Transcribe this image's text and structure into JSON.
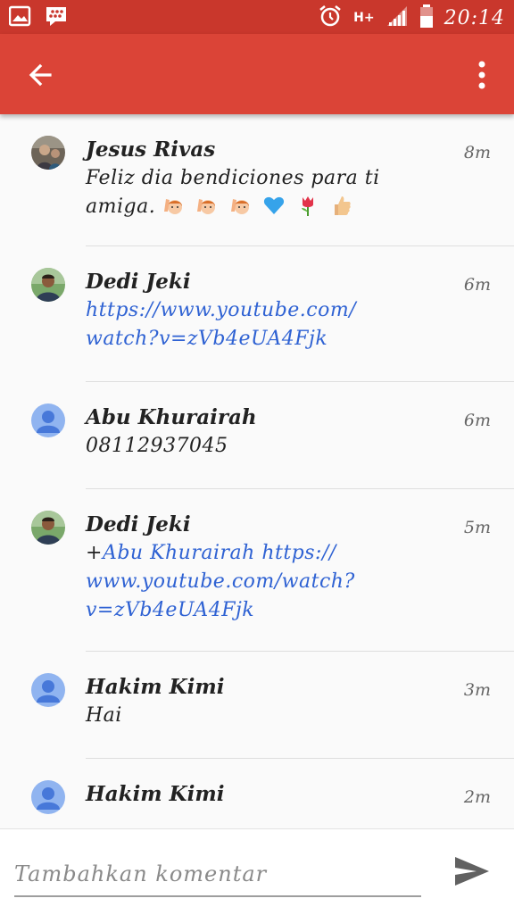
{
  "status_bar": {
    "network": "H+",
    "time": "20:14",
    "icons": [
      "image-icon",
      "bbm-icon",
      "alarm-icon",
      "signal-icon",
      "battery-icon"
    ]
  },
  "app_bar": {
    "icons": [
      "back-arrow-icon",
      "more-vert-icon"
    ]
  },
  "comments": [
    {
      "author": "Jesus Rivas",
      "time": "8m",
      "text_line1": "Feliz dia bendiciones para ti",
      "text_line2": "amiga.",
      "emojis": [
        "raised-hand-boy-emoji",
        "raised-hand-boy-emoji",
        "raised-hand-boy-emoji",
        "blue-heart-emoji",
        "tulip-emoji",
        "thumbs-up-emoji"
      ],
      "avatar": "photo"
    },
    {
      "author": "Dedi Jeki",
      "time": "6m",
      "link_line1": "https://www.youtube.com/",
      "link_line2": "watch?v=zVb4eUA4Fjk",
      "avatar": "photo"
    },
    {
      "author": "Abu Khurairah",
      "time": "6m",
      "text": "08112937045",
      "avatar": "default"
    },
    {
      "author": "Dedi Jeki",
      "time": "5m",
      "prefix": "+",
      "mention": "Abu Khurairah",
      "link_line1": "https://",
      "link_line2": "www.youtube.com/watch?",
      "link_line3": "v=zVb4eUA4Fjk",
      "avatar": "photo"
    },
    {
      "author": "Hakim Kimi",
      "time": "3m",
      "text": "Hai",
      "avatar": "default"
    },
    {
      "author": "Hakim Kimi",
      "time": "2m",
      "avatar": "default"
    }
  ],
  "composer": {
    "placeholder": "Tambahkan komentar"
  },
  "colors": {
    "status_bar": "#c9372c",
    "app_bar": "#db4437",
    "link": "#2f62d3",
    "default_avatar": "#90b4f0"
  }
}
